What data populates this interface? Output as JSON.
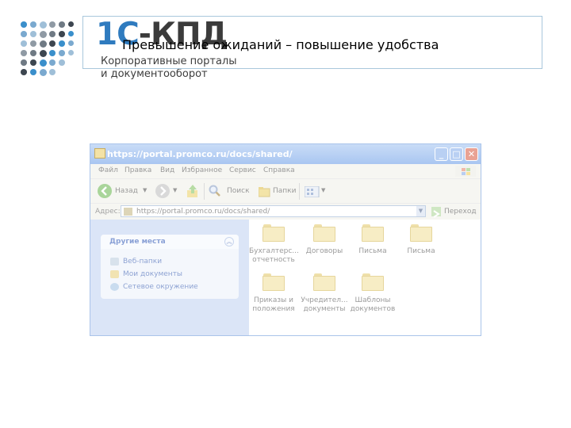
{
  "header": {
    "brand_part1": "1С",
    "brand_part2": "-КПД",
    "tagline_line1": "Корпоративные порталы",
    "tagline_line2": "и документооборот",
    "slide_title": "Превышение ожиданий – повышение удобства"
  },
  "colors": {
    "brand_blue": "#2f7bbf",
    "brand_dark": "#3b3b3b",
    "window_frame": "#aac4ea",
    "task_text": "#8aa1d6"
  },
  "window": {
    "title": "https://portal.promco.ru/docs/shared/",
    "buttons": [
      {
        "icon": "minimize-icon",
        "glyph": "_"
      },
      {
        "icon": "maximize-icon",
        "glyph": "□"
      },
      {
        "icon": "close-icon",
        "glyph": "✕"
      }
    ],
    "menu": [
      "Файл",
      "Правка",
      "Вид",
      "Избранное",
      "Сервис",
      "Справка"
    ],
    "toolbar": {
      "back_label": "Назад",
      "search_label": "Поиск",
      "folders_label": "Папки"
    },
    "address": {
      "label": "Адрес:",
      "value": "https://portal.promco.ru/docs/shared/",
      "go_label": "Переход"
    },
    "task_pane": {
      "title": "Другие места",
      "links": [
        {
          "label": "Веб-папки",
          "icon": "web-folders-icon"
        },
        {
          "label": "Мои документы",
          "icon": "my-documents-icon"
        },
        {
          "label": "Сетевое окружение",
          "icon": "network-icon"
        }
      ]
    },
    "folders": [
      {
        "name": "Бухгалтерс...\nотчетность"
      },
      {
        "name": "Договоры"
      },
      {
        "name": "Письма"
      },
      {
        "name": "Письма"
      },
      {
        "name": "Приказы и\nположения"
      },
      {
        "name": "Учредител...\nдокументы"
      },
      {
        "name": "Шаблоны\nдокументов"
      }
    ]
  }
}
